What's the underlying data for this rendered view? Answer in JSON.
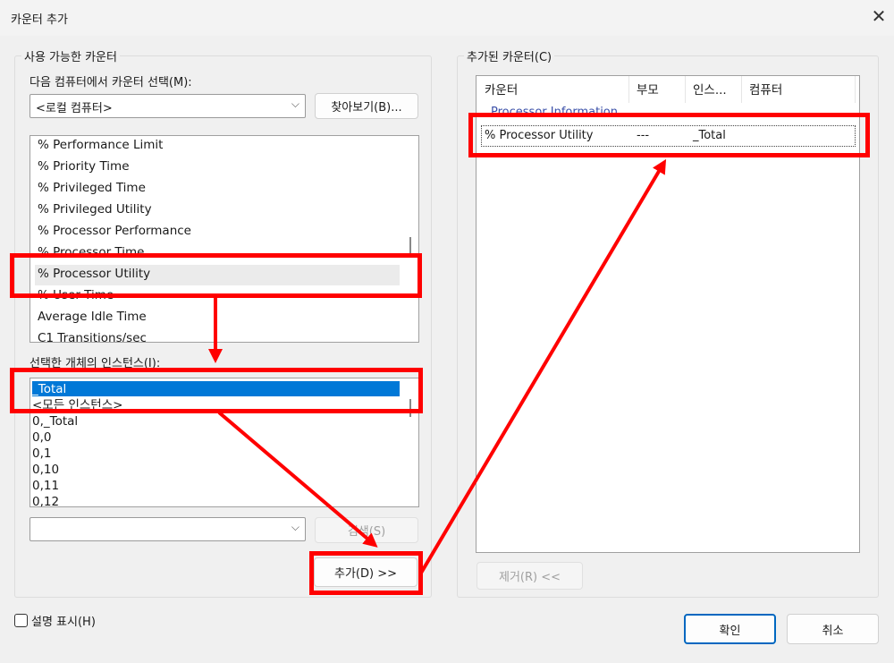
{
  "window": {
    "title": "카운터 추가",
    "close_icon": "close-icon"
  },
  "available": {
    "legend": "사용 가능한 카운터",
    "computer_label": "다음 컴퓨터에서 카운터 선택(M):",
    "computer_value": "<로컬 컴퓨터>",
    "browse_label": "찾아보기(B)...",
    "counters": [
      "% Performance Limit",
      "% Priority Time",
      "% Privileged Time",
      "% Privileged Utility",
      "% Processor Performance",
      "% Processor Time",
      "% Processor Utility",
      "% User Time",
      "Average Idle Time",
      "C1 Transitions/sec"
    ],
    "selected_counter": "% Processor Utility",
    "instances_label": "선택한 개체의 인스턴스(I):",
    "instances": [
      "_Total",
      "<모든 인스턴스>",
      "0,_Total",
      "0,0",
      "0,1",
      "0,10",
      "0,11",
      "0,12"
    ],
    "selected_instance": "_Total",
    "search_value": "",
    "search_label": "검색(S)",
    "add_label": "추가(D) >>"
  },
  "added": {
    "legend": "추가된 카운터(C)",
    "columns": [
      "카운터",
      "부모",
      "인스...",
      "컴퓨터"
    ],
    "group": "Processor Information",
    "rows": [
      {
        "counter": "% Processor Utility",
        "parent": "---",
        "instance": "_Total",
        "computer": ""
      }
    ],
    "remove_label": "제거(R) <<"
  },
  "footer": {
    "show_description_label": "설명 표시(H)",
    "show_description_checked": false,
    "ok_label": "확인",
    "cancel_label": "취소"
  },
  "colors": {
    "annotation": "#ff0000",
    "selection": "#0078d7",
    "ok_border": "#0067c0"
  }
}
